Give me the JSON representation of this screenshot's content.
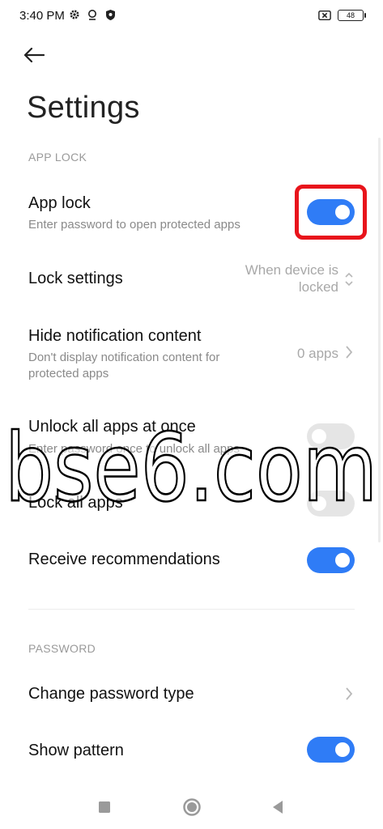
{
  "status_bar": {
    "time": "3:40 PM",
    "battery_level": "48",
    "icons": [
      "gear-icon",
      "location-icon",
      "shield-icon",
      "no-sim-icon",
      "battery-icon"
    ]
  },
  "header": {
    "back_icon": "arrow-left-icon",
    "title": "Settings"
  },
  "sections": {
    "app_lock_label": "APP LOCK",
    "password_label": "PASSWORD"
  },
  "app_lock": {
    "title": "App lock",
    "subtitle": "Enter password to open protected apps",
    "enabled": true
  },
  "lock_settings": {
    "title": "Lock settings",
    "value_line1": "When device is",
    "value_line2": "locked"
  },
  "hide_notification": {
    "title": "Hide notification content",
    "subtitle_line1": "Don't display notification content for",
    "subtitle_line2": "protected apps",
    "value": "0 apps"
  },
  "unlock_all": {
    "title": "Unlock all apps at once",
    "subtitle": "Enter password once to unlock all apps",
    "enabled": false
  },
  "lock_all": {
    "title": "Lock all apps",
    "enabled": false
  },
  "recommendations": {
    "title": "Receive recommendations",
    "enabled": true
  },
  "change_password": {
    "title": "Change password type"
  },
  "show_pattern": {
    "title": "Show pattern",
    "enabled": true
  },
  "watermark": {
    "text": "bse6.com"
  },
  "colors": {
    "toggle_on": "#2f7cf6",
    "highlight": "#e8141b",
    "section_label": "#9a9a9a"
  }
}
